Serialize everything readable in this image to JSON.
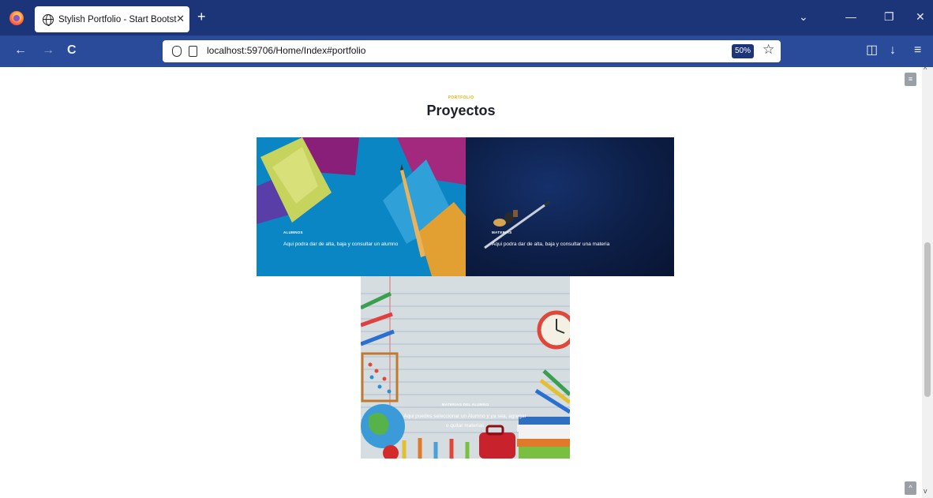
{
  "browser": {
    "tab_title": "Stylish Portfolio - Start Bootstra",
    "tab_close": "✕",
    "new_tab": "+",
    "url": "localhost:59706/Home/Index#portfolio",
    "zoom": "50%",
    "window_controls": {
      "list_all_tabs": "⌄",
      "minimize": "—",
      "restore": "❐",
      "close": "✕"
    },
    "nav": {
      "back": "←",
      "forward": "→",
      "reload": "C",
      "star": "☆",
      "pocket": "◫",
      "downloads": "↓",
      "menu": "≡"
    },
    "accent": "#1c3578",
    "toolbar_color": "#2a4a9a"
  },
  "page": {
    "section_subheading": "PORTFOLIO",
    "section_heading": "Proyectos",
    "cards": [
      {
        "title": "ALUMNOS",
        "text": "Aqui podra dar de alta, baja y consultar un alumno"
      },
      {
        "title": "MATERIAS",
        "text": "Aqui podra dar de alta, baja y consultar una materia"
      },
      {
        "title": "MATERIAS DEL ALUMNO",
        "text": "Aqui puedes seleccionar un Alumno y ya sea, agregar o quitar materias"
      }
    ],
    "menu_toggle": "≡",
    "scroll_to_top": "^",
    "subheading_color": "#e8b20f"
  }
}
